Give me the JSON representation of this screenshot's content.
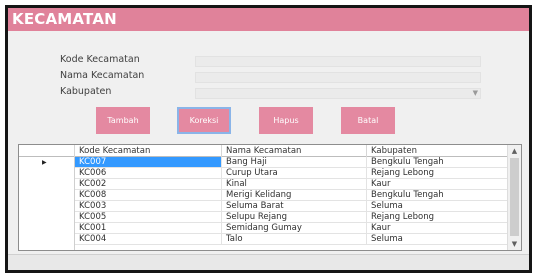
{
  "window": {
    "title": "KECAMATAN"
  },
  "form": {
    "kode_label": "Kode Kecamatan",
    "nama_label": "Nama Kecamatan",
    "kabupaten_label": "Kabupaten",
    "kode_value": "",
    "nama_value": "",
    "kabupaten_value": ""
  },
  "buttons": {
    "tambah": "Tambah",
    "koreksi": "Koreksi",
    "hapus": "Hapus",
    "batal": "Batal"
  },
  "grid": {
    "columns": [
      "Kode Kecamatan",
      "Nama Kecamatan",
      "Kabupaten"
    ],
    "rows": [
      [
        "KC007",
        "Bang Haji",
        "Bengkulu Tengah"
      ],
      [
        "KC006",
        "Curup Utara",
        "Rejang Lebong"
      ],
      [
        "KC002",
        "Kinal",
        "Kaur"
      ],
      [
        "KC008",
        "Merigi Kelidang",
        "Bengkulu Tengah"
      ],
      [
        "KC003",
        "Seluma Barat",
        "Seluma"
      ],
      [
        "KC005",
        "Selupu Rejang",
        "Rejang Lebong"
      ],
      [
        "KC001",
        "Semidang Gumay",
        "Kaur"
      ],
      [
        "KC004",
        "Talo",
        "Seluma"
      ]
    ],
    "selected_row": 0
  },
  "icons": {
    "row_indicator": "triangle-right",
    "combo_arrow": "chevron-down",
    "scroll_up": "chevron-up",
    "scroll_down": "chevron-down"
  },
  "colors": {
    "accent": "#e0829a",
    "button": "#e489a1",
    "selection": "#3399ff"
  }
}
